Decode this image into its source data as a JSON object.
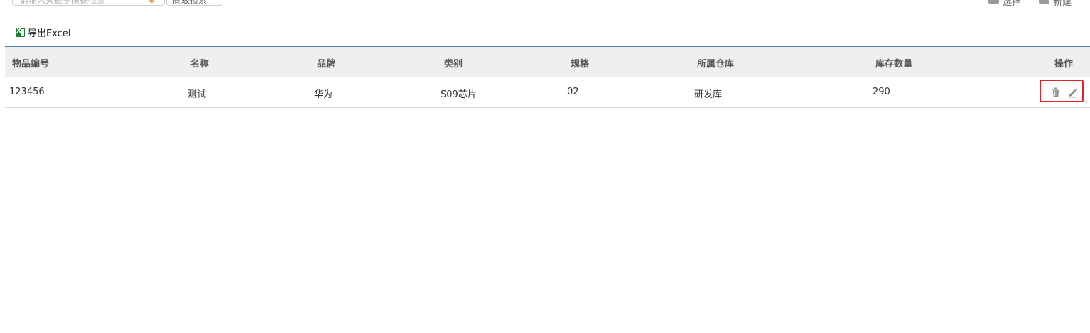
{
  "toolbar": {
    "search_placeholder": "请输入关键字模糊检索",
    "query_button_label": "高级检索",
    "choose_label": "选择",
    "new_label": "新建",
    "export_label": "导出Excel"
  },
  "table": {
    "columns": [
      "物品编号",
      "名称",
      "品牌",
      "类别",
      "规格",
      "所属仓库",
      "库存数量",
      "操作"
    ],
    "rows": [
      {
        "item_no": "123456",
        "name": "测试",
        "brand": "华为",
        "category": "S09芯片",
        "spec": "02",
        "warehouse": "研发库",
        "stock": "290"
      }
    ]
  },
  "icons": {
    "export": "excel-icon",
    "delete": "trash-icon",
    "edit": "pencil-icon"
  },
  "colors": {
    "header_accent": "#4d77b5",
    "highlight_border": "#e8212a",
    "icon_gray": "#8c8c8c"
  }
}
